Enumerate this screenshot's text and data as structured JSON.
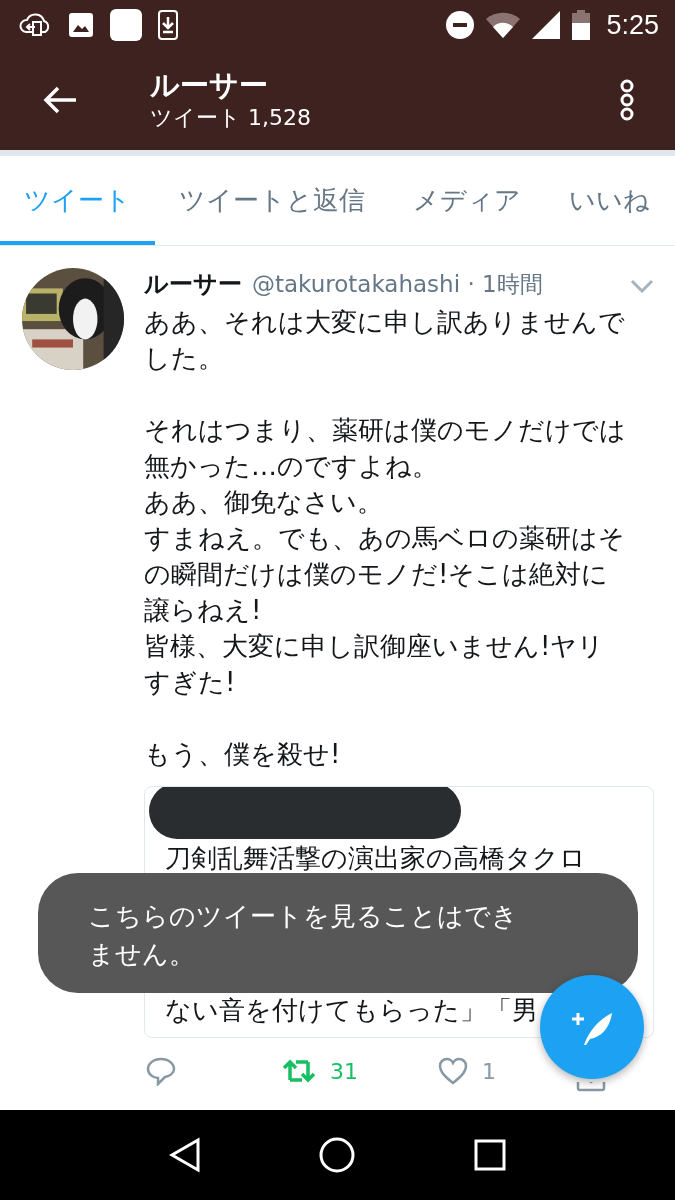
{
  "status_bar": {
    "time": "5:25"
  },
  "app_bar": {
    "title": "ルーサー",
    "subtitle": "ツイート 1,528"
  },
  "tabs": [
    {
      "label": "ツイート",
      "selected": true
    },
    {
      "label": "ツイートと返信",
      "selected": false
    },
    {
      "label": "メディア",
      "selected": false
    },
    {
      "label": "いいね",
      "selected": false
    }
  ],
  "tweet": {
    "name": "ルーサー",
    "handle": "@takurotakahashi · 1時間",
    "paragraphs": [
      [
        "ああ、それは大変に申し訳ありませんで",
        "した。"
      ],
      [
        "それはつまり、薬研は僕のモノだけでは",
        "無かった…のですよね。",
        "ああ、御免なさい。",
        "すまねえ。でも、あの馬ベロの薬研はそ",
        "の瞬間だけは僕のモノだ!そこは絶対に",
        "譲らねえ!",
        "皆様、大変に申し訳御座いません!ヤリ",
        "すぎた!"
      ],
      [
        "もう、僕を殺せ!"
      ]
    ],
    "quote": {
      "lines": [
        "刀剣乱舞活撃の演出家の高橋タクロ",
        "ない音を付けてもらった」「男"
      ]
    },
    "actions": {
      "retweets": "31",
      "retweeted": true,
      "likes": "1",
      "liked": false
    }
  },
  "toast": {
    "text": "こちらのツイートを見ることはできません。"
  }
}
